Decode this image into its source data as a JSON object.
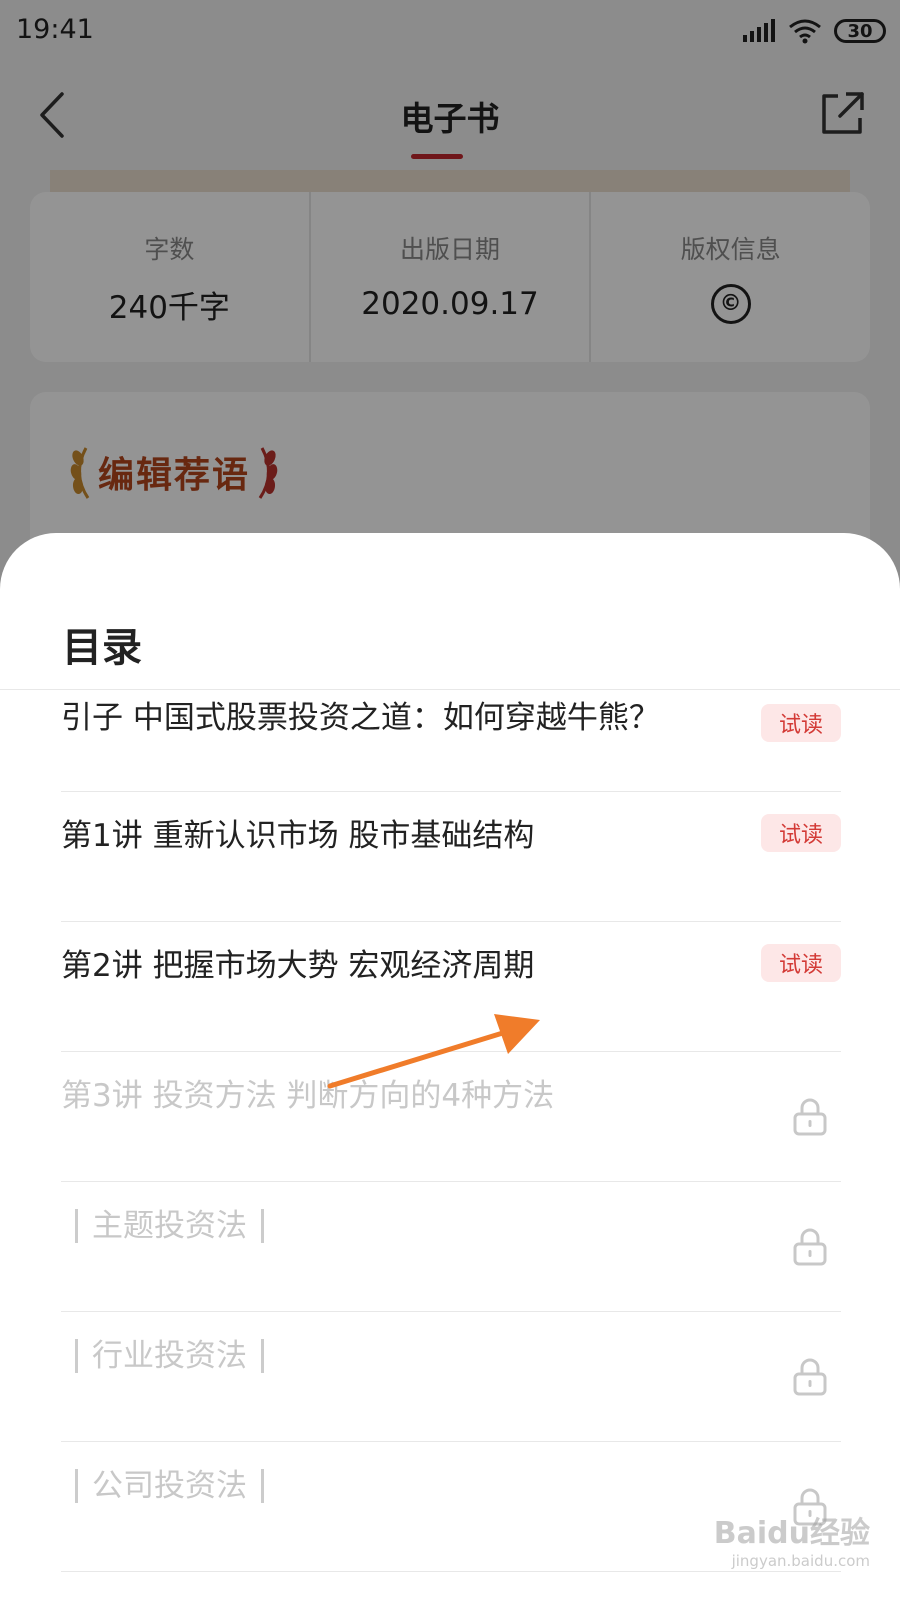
{
  "status_bar": {
    "time": "19:41",
    "battery": "30"
  },
  "nav": {
    "title": "电子书"
  },
  "book_info": [
    {
      "label": "字数",
      "value": "240千字"
    },
    {
      "label": "出版日期",
      "value": "2020.09.17"
    },
    {
      "label": "版权信息",
      "value": "©"
    }
  ],
  "editor_card": {
    "title": "编辑荐语"
  },
  "toc": {
    "title": "目录",
    "items": [
      {
        "text": "引子 中国式股票投资之道：如何穿越牛熊？",
        "badge": "试读"
      },
      {
        "text": "第1讲 重新认识市场 股市基础结构",
        "badge": "试读"
      },
      {
        "text": "第2讲 把握市场大势 宏观经济周期",
        "badge": "试读"
      },
      {
        "text": "第3讲 投资方法 判断方向的4种方法",
        "icon": "lock-icon"
      },
      {
        "text": "主题投资法",
        "icon": "lock-icon"
      },
      {
        "text": "行业投资法",
        "icon": "lock-icon"
      },
      {
        "text": "公司投资法",
        "icon": "lock-icon"
      }
    ]
  },
  "annotation": {
    "arrow_color": "#f07c2a"
  },
  "watermark": {
    "main": "Baidu经验",
    "sub": "jingyan.baidu.com"
  },
  "colors": {
    "accent": "#c0272d",
    "badge_text": "#d33a36",
    "badge_bg": "#fde7e7"
  }
}
